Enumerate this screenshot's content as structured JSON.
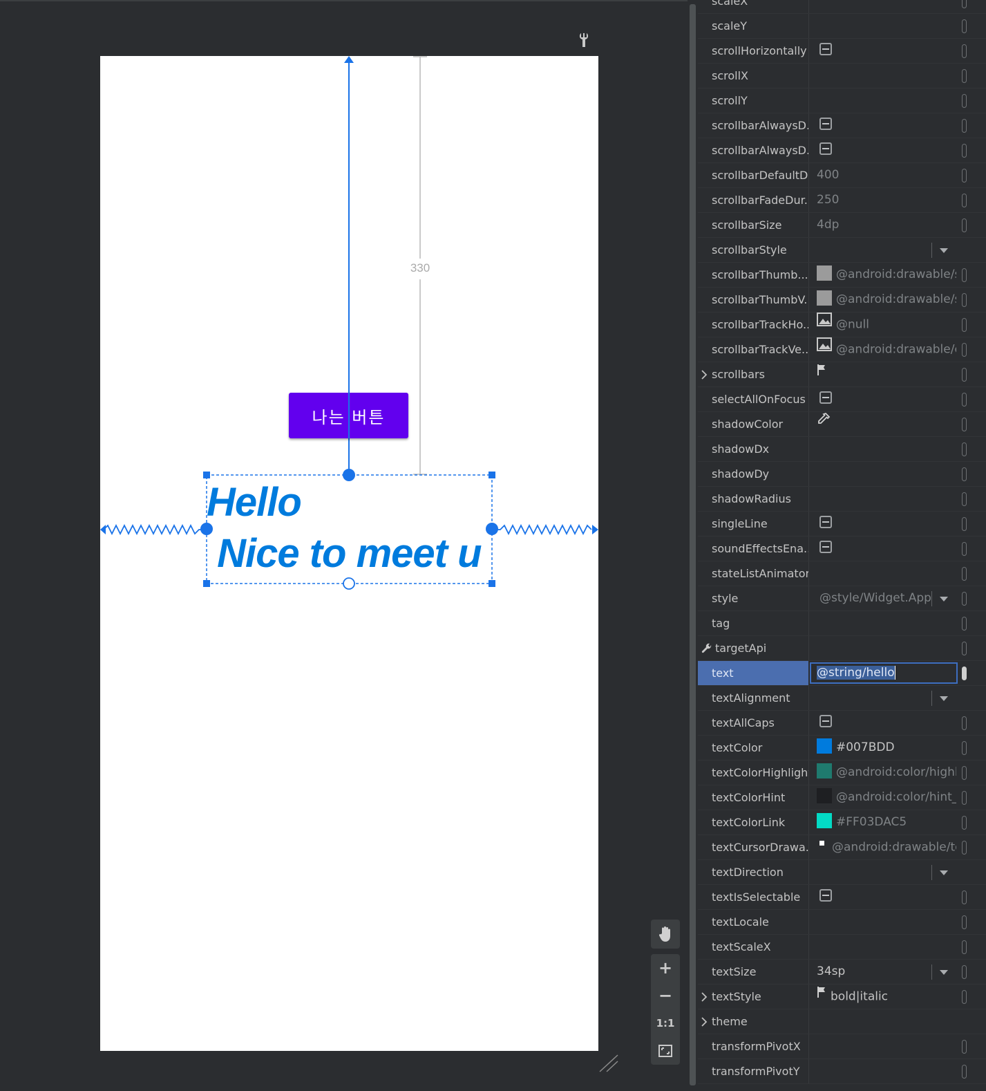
{
  "canvas": {
    "button_label": "나는 버튼",
    "text_line1": "Hello",
    "text_line2": " Nice to meet u",
    "margin_top_dimension": "330"
  },
  "zoom_toolbar": {
    "zoom_in": "+",
    "zoom_out": "−",
    "actual_size": "1:1"
  },
  "attributes": [
    {
      "name": "scaleX"
    },
    {
      "name": "scaleY"
    },
    {
      "name": "scrollHorizontally",
      "control": "checkbox"
    },
    {
      "name": "scrollX"
    },
    {
      "name": "scrollY"
    },
    {
      "name": "scrollbarAlwaysD...",
      "control": "checkbox"
    },
    {
      "name": "scrollbarAlwaysD...",
      "control": "checkbox"
    },
    {
      "name": "scrollbarDefaultD...",
      "value": "400"
    },
    {
      "name": "scrollbarFadeDur...",
      "value": "250"
    },
    {
      "name": "scrollbarSize",
      "value": "4dp"
    },
    {
      "name": "scrollbarStyle",
      "control": "dropdown"
    },
    {
      "name": "scrollbarThumb...",
      "swatch": "#9b9b9b",
      "value": "@android:drawable/sc"
    },
    {
      "name": "scrollbarThumbV...",
      "swatch": "#9b9b9b",
      "value": "@android:drawable/sc"
    },
    {
      "name": "scrollbarTrackHo...",
      "icon": "image-icon",
      "value": "@null"
    },
    {
      "name": "scrollbarTrackVe...",
      "icon": "image-icon",
      "value": "@android:drawable/cc"
    },
    {
      "name": "scrollbars",
      "expandable": true,
      "icon": "flag-icon"
    },
    {
      "name": "selectAllOnFocus",
      "control": "checkbox"
    },
    {
      "name": "shadowColor",
      "icon": "eyedropper-icon"
    },
    {
      "name": "shadowDx"
    },
    {
      "name": "shadowDy"
    },
    {
      "name": "shadowRadius"
    },
    {
      "name": "singleLine",
      "control": "checkbox"
    },
    {
      "name": "soundEffectsEna...",
      "control": "checkbox"
    },
    {
      "name": "stateListAnimator"
    },
    {
      "name": "style",
      "value": "@style/Widget.App",
      "control": "dropdown"
    },
    {
      "name": "tag"
    },
    {
      "name": "targetApi",
      "lead_icon": "wrench-icon"
    },
    {
      "name": "text",
      "selected": true,
      "value": "@string/hello"
    },
    {
      "name": "textAlignment",
      "control": "dropdown"
    },
    {
      "name": "textAllCaps",
      "control": "checkbox"
    },
    {
      "name": "textColor",
      "swatch": "#007BDD",
      "value": "#007BDD",
      "bright": true
    },
    {
      "name": "textColorHighlight",
      "swatch": "#1f7a6e",
      "value": "@android:color/highli"
    },
    {
      "name": "textColorHint",
      "swatch": "#1e1f22",
      "value": "@android:color/hint_f"
    },
    {
      "name": "textColorLink",
      "swatch": "#03DAC5",
      "value": "#FF03DAC5"
    },
    {
      "name": "textCursorDrawa...",
      "icon": "cursor-drawable-icon",
      "value": "@android:drawable/te"
    },
    {
      "name": "textDirection",
      "control": "dropdown"
    },
    {
      "name": "textIsSelectable",
      "control": "checkbox"
    },
    {
      "name": "textLocale"
    },
    {
      "name": "textScaleX"
    },
    {
      "name": "textSize",
      "value": " 34sp",
      "control": "dropdown",
      "bright": true
    },
    {
      "name": "textStyle",
      "expandable": true,
      "icon": "flag-icon",
      "value": "bold|italic",
      "bright": true
    },
    {
      "name": "theme",
      "expandable": true,
      "no_pin": true
    },
    {
      "name": "transformPivotX"
    },
    {
      "name": "transformPivotY"
    }
  ],
  "colors": {
    "button": "#6200ee",
    "text_color": "#007bdd",
    "selection_blue": "#1a73e8",
    "panel_bg": "#2b2d30"
  }
}
